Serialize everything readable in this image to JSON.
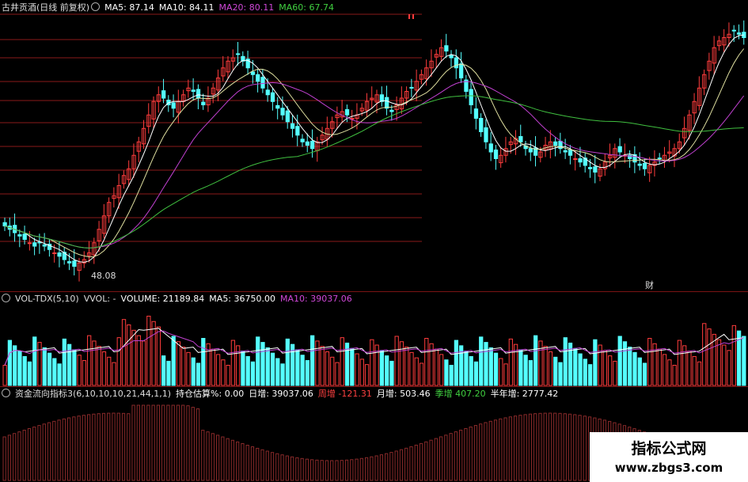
{
  "price_panel": {
    "title": "古井贡酒(日线 前复权)",
    "ma": [
      {
        "label": "MA5:",
        "value": "87.14",
        "color": "#ffffff"
      },
      {
        "label": "MA10:",
        "value": "84.11",
        "color": "#ffffff"
      },
      {
        "label": "MA20:",
        "value": "80.11",
        "color": "#d048d8"
      },
      {
        "label": "MA60:",
        "value": "67.74",
        "color": "#40d040"
      }
    ],
    "low_label": "48.08",
    "cai_label": "财"
  },
  "volume_panel": {
    "name": "VOL-TDX(5,10)",
    "vvol": "VVOL: -",
    "volume_label": "VOLUME:",
    "volume_value": "21189.84",
    "ma5_label": "MA5:",
    "ma5_value": "36750.00",
    "ma10_label": "MA10:",
    "ma10_value": "39037.06"
  },
  "fund_panel": {
    "name": "资金流向指标3(6,10,10,10,21,44,1,1)",
    "items": [
      {
        "label": "持仓估算%:",
        "value": "0.00",
        "color": "#ffffff"
      },
      {
        "label": "日增:",
        "value": "39037.06",
        "color": "#ffffff"
      },
      {
        "label": "周增",
        "value": "-121.31",
        "color": "#ff4040"
      },
      {
        "label": "月增:",
        "value": "503.46",
        "color": "#ffffff"
      },
      {
        "label": "季增",
        "value": "407.20",
        "color": "#40d040"
      },
      {
        "label": "半年增:",
        "value": "2777.42",
        "color": "#ffffff"
      }
    ]
  },
  "watermark": {
    "line1": "指标公式网",
    "line2": "www.zbgs3.com"
  },
  "colors": {
    "up": "#ff3c3c",
    "down": "#54ffff",
    "ma5": "#ffffff",
    "ma10": "#e0e0a0",
    "ma20": "#c040d0",
    "ma60": "#40c040",
    "grid": "#8a1a1a"
  },
  "chart_data": {
    "type": "candlestick",
    "closes": [
      63,
      62,
      61,
      60,
      59,
      58,
      57,
      58,
      57,
      56,
      55,
      54,
      53,
      52,
      51,
      52,
      53,
      55,
      58,
      62,
      66,
      70,
      72,
      75,
      78,
      80,
      84,
      88,
      92,
      96,
      100,
      102,
      101,
      99,
      98,
      100,
      102,
      104,
      103,
      101,
      99,
      101,
      104,
      107,
      110,
      112,
      113,
      114,
      112,
      110,
      108,
      106,
      104,
      102,
      100,
      98,
      96,
      94,
      92,
      90,
      88,
      87,
      86,
      88,
      90,
      92,
      94,
      96,
      97,
      96,
      95,
      96,
      98,
      100,
      101,
      102,
      100,
      98,
      97,
      99,
      101,
      103,
      104,
      106,
      108,
      110,
      112,
      114,
      116,
      115,
      113,
      110,
      107,
      103,
      99,
      95,
      91,
      88,
      85,
      83,
      84,
      86,
      88,
      89,
      88,
      86,
      85,
      84,
      85,
      87,
      88,
      87,
      86,
      85,
      84,
      83,
      82,
      81,
      80,
      79,
      80,
      82,
      84,
      86,
      85,
      84,
      83,
      82,
      81,
      80,
      81,
      82,
      83,
      84,
      85,
      86,
      88,
      92,
      96,
      100,
      104,
      108,
      112,
      116,
      118,
      119,
      120,
      121,
      120,
      119
    ]
  }
}
